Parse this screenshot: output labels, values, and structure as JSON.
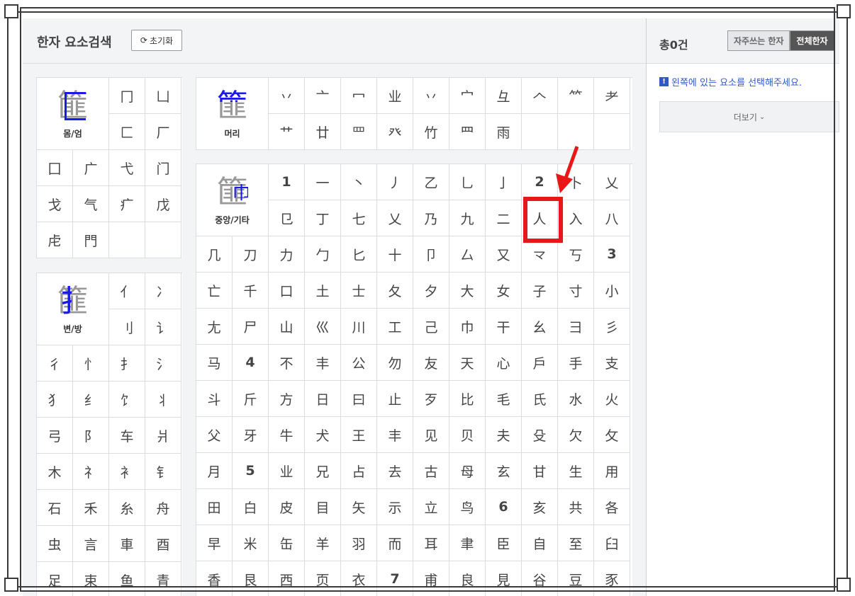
{
  "header": {
    "title": "한자 요소검색",
    "reset_label": "초기화"
  },
  "groups": {
    "body": {
      "label": "몸/엄",
      "glyph_pre": "",
      "glyph_hl": "",
      "glyph_rest": "篚",
      "cells": [
        "冂",
        "凵",
        "匚",
        "厂",
        "囗",
        "广",
        "弋",
        "门",
        "戈",
        "气",
        "疒",
        "戊",
        "虍",
        "門",
        "",
        ""
      ]
    },
    "side": {
      "label": "변/방",
      "glyph_pre": "",
      "glyph_hl": "",
      "glyph_rest": "篚",
      "cells": [
        "亻",
        "冫",
        "刂",
        "讠",
        "彳",
        "忄",
        "扌",
        "氵",
        "犭",
        "纟",
        "饣",
        "丬",
        "弓",
        "阝",
        "车",
        "爿",
        "木",
        "礻",
        "衤",
        "钅",
        "石",
        "禾",
        "糸",
        "舟",
        "虫",
        "言",
        "車",
        "酉",
        "足",
        "束",
        "鱼",
        "青"
      ]
    },
    "head": {
      "label": "머리",
      "glyph_pre": "",
      "glyph_hl": "",
      "glyph_rest": "篚",
      "cells": [
        "丷",
        "亠",
        "冖",
        "业",
        "丷",
        "宀",
        "彑",
        "𠆢",
        "⺮",
        "⺹",
        "艹",
        "廿",
        "罒",
        "癶",
        "竹",
        "⺲",
        "雨",
        "",
        "",
        " "
      ]
    },
    "middle": {
      "label": "중앙/기타",
      "glyph_rest": "篚",
      "cells": [
        {
          "t": "1",
          "n": true
        },
        {
          "t": "一"
        },
        {
          "t": "丶"
        },
        {
          "t": "丿"
        },
        {
          "t": "乙"
        },
        {
          "t": "乚"
        },
        {
          "t": "亅"
        },
        {
          "t": "2",
          "n": true
        },
        {
          "t": "卜"
        },
        {
          "t": "乂"
        },
        {
          "t": "㔾"
        },
        {
          "t": "丁"
        },
        {
          "t": "七"
        },
        {
          "t": "乂"
        },
        {
          "t": "乃"
        },
        {
          "t": "九"
        },
        {
          "t": "二"
        },
        {
          "t": "人"
        },
        {
          "t": "入"
        },
        {
          "t": "八"
        },
        {
          "t": "几"
        },
        {
          "t": "刀"
        },
        {
          "t": "力"
        },
        {
          "t": "勹"
        },
        {
          "t": "匕"
        },
        {
          "t": "十"
        },
        {
          "t": "卩"
        },
        {
          "t": "厶"
        },
        {
          "t": "又"
        },
        {
          "t": "龴"
        },
        {
          "t": "丂"
        },
        {
          "t": "3",
          "n": true
        },
        {
          "t": "亡"
        },
        {
          "t": "千"
        },
        {
          "t": "口"
        },
        {
          "t": "土"
        },
        {
          "t": "士"
        },
        {
          "t": "夂"
        },
        {
          "t": "夕"
        },
        {
          "t": "大"
        },
        {
          "t": "女"
        },
        {
          "t": "子"
        },
        {
          "t": "寸"
        },
        {
          "t": "小"
        },
        {
          "t": "尢"
        },
        {
          "t": "尸"
        },
        {
          "t": "山"
        },
        {
          "t": "巛"
        },
        {
          "t": "川"
        },
        {
          "t": "工"
        },
        {
          "t": "己"
        },
        {
          "t": "巾"
        },
        {
          "t": "干"
        },
        {
          "t": "幺"
        },
        {
          "t": "彐"
        },
        {
          "t": "彡"
        },
        {
          "t": "马"
        },
        {
          "t": "4",
          "n": true
        },
        {
          "t": "不"
        },
        {
          "t": "丰"
        },
        {
          "t": "公"
        },
        {
          "t": "勿"
        },
        {
          "t": "友"
        },
        {
          "t": "天"
        },
        {
          "t": "心"
        },
        {
          "t": "戶"
        },
        {
          "t": "手"
        },
        {
          "t": "支"
        },
        {
          "t": "斗"
        },
        {
          "t": "斤"
        },
        {
          "t": "方"
        },
        {
          "t": "日"
        },
        {
          "t": "曰"
        },
        {
          "t": "止"
        },
        {
          "t": "歹"
        },
        {
          "t": "比"
        },
        {
          "t": "毛"
        },
        {
          "t": "氏"
        },
        {
          "t": "水"
        },
        {
          "t": "火"
        },
        {
          "t": "父"
        },
        {
          "t": "牙"
        },
        {
          "t": "牛"
        },
        {
          "t": "犬"
        },
        {
          "t": "王"
        },
        {
          "t": "丰"
        },
        {
          "t": "见"
        },
        {
          "t": "贝"
        },
        {
          "t": "夫"
        },
        {
          "t": "殳"
        },
        {
          "t": "欠"
        },
        {
          "t": "攵"
        },
        {
          "t": "月"
        },
        {
          "t": "5",
          "n": true
        },
        {
          "t": "业"
        },
        {
          "t": "兄"
        },
        {
          "t": "占"
        },
        {
          "t": "去"
        },
        {
          "t": "古"
        },
        {
          "t": "母"
        },
        {
          "t": "玄"
        },
        {
          "t": "甘"
        },
        {
          "t": "生"
        },
        {
          "t": "用"
        },
        {
          "t": "田"
        },
        {
          "t": "白"
        },
        {
          "t": "皮"
        },
        {
          "t": "目"
        },
        {
          "t": "矢"
        },
        {
          "t": "示"
        },
        {
          "t": "立"
        },
        {
          "t": "鸟"
        },
        {
          "t": "6",
          "n": true
        },
        {
          "t": "亥"
        },
        {
          "t": "共"
        },
        {
          "t": "各"
        },
        {
          "t": "早"
        },
        {
          "t": "米"
        },
        {
          "t": "缶"
        },
        {
          "t": "羊"
        },
        {
          "t": "羽"
        },
        {
          "t": "而"
        },
        {
          "t": "耳"
        },
        {
          "t": "聿"
        },
        {
          "t": "臣"
        },
        {
          "t": "自"
        },
        {
          "t": "至"
        },
        {
          "t": "臼"
        },
        {
          "t": "香"
        },
        {
          "t": "艮"
        },
        {
          "t": "西"
        },
        {
          "t": "页"
        },
        {
          "t": "衣"
        },
        {
          "t": "7",
          "n": true
        },
        {
          "t": "甫"
        },
        {
          "t": "良"
        },
        {
          "t": "見"
        },
        {
          "t": "谷"
        },
        {
          "t": "豆"
        },
        {
          "t": "豕"
        }
      ]
    }
  },
  "right": {
    "total_label": "총0건",
    "tab_frequent": "자주쓰는 한자",
    "tab_all": "전체한자",
    "notice": "왼쪽에 있는 요소를 선택해주세요.",
    "more_label": "더보기"
  },
  "colors": {
    "highlight": "#1a1ae6",
    "annotation": "#e81818",
    "notice": "#3358c4"
  }
}
